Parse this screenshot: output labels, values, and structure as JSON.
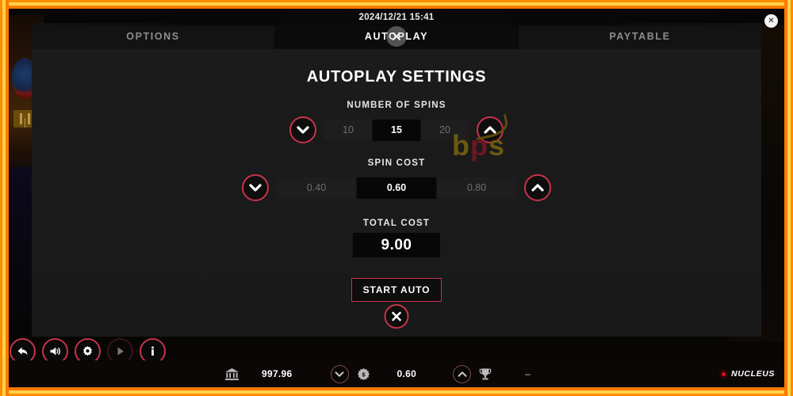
{
  "window": {
    "datetime": "2024/12/21 15:41",
    "close_icon": "close-icon"
  },
  "tabs": [
    {
      "label": "OPTIONS",
      "active": false
    },
    {
      "label": "AUTOPLAY",
      "active": true
    },
    {
      "label": "PAYTABLE",
      "active": false
    }
  ],
  "panel": {
    "title": "AUTOPLAY SETTINGS",
    "spins": {
      "label": "NUMBER OF SPINS",
      "values": [
        "10",
        "15",
        "20"
      ],
      "selected": "15",
      "decrease_icon": "chevron-down-icon",
      "increase_icon": "chevron-up-icon"
    },
    "cost": {
      "label": "SPIN COST",
      "values": [
        "0.40",
        "0.60",
        "0.80"
      ],
      "selected": "0.60",
      "decrease_icon": "chevron-down-icon",
      "increase_icon": "chevron-up-icon"
    },
    "total": {
      "label": "TOTAL COST",
      "value": "9.00"
    },
    "start_button": "START AUTO",
    "close_icon": "close-icon"
  },
  "watermark": {
    "part1": "b",
    "part2": "p",
    "part3": "s"
  },
  "controls": [
    {
      "name": "back-button",
      "icon": "back-arrow-icon",
      "disabled": false
    },
    {
      "name": "sound-button",
      "icon": "speaker-icon",
      "disabled": false
    },
    {
      "name": "settings-button",
      "icon": "gear-icon",
      "disabled": false
    },
    {
      "name": "spin-button",
      "icon": "play-icon",
      "disabled": true
    },
    {
      "name": "info-button",
      "icon": "info-icon",
      "disabled": false
    }
  ],
  "statusbar": {
    "bank_icon": "bank-icon",
    "balance": "997.96",
    "bet_decrease_icon": "chevron-down-icon",
    "coin_icon": "coin-icon",
    "bet": "0.60",
    "bet_increase_icon": "chevron-up-icon",
    "trophy_icon": "trophy-icon",
    "win": "–",
    "brand": "NUCLEUS"
  },
  "colors": {
    "accent_red": "#c7334a",
    "frame_orange": "#ff8c00",
    "frame_yellow": "#ffd24a",
    "panel_bg": "#1a1a1a",
    "selected_bg": "#070707"
  }
}
